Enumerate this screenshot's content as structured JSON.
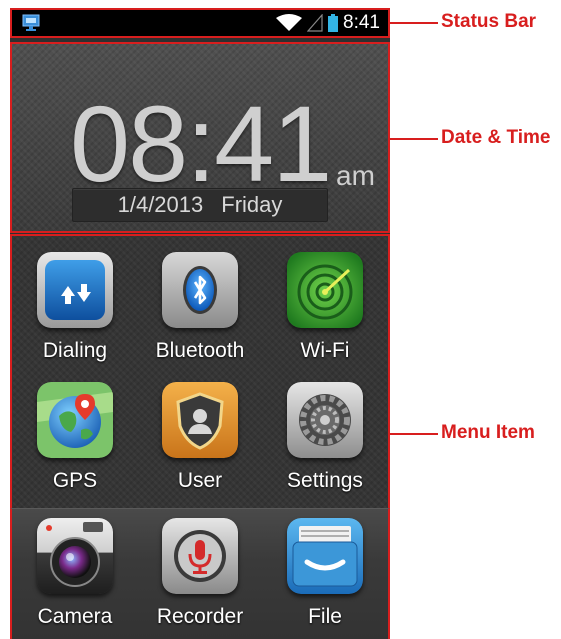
{
  "status_bar": {
    "time": "8:41",
    "icons": [
      "monitor-icon",
      "wifi-icon",
      "signal-icon",
      "battery-icon"
    ]
  },
  "clock": {
    "time": "08:41",
    "ampm": "am",
    "date": "1/4/2013",
    "day": "Friday"
  },
  "apps": [
    {
      "label": "Dialing",
      "icon": "dialing-icon"
    },
    {
      "label": "Bluetooth",
      "icon": "bluetooth-icon"
    },
    {
      "label": "Wi-Fi",
      "icon": "wifi-radar-icon"
    },
    {
      "label": "GPS",
      "icon": "gps-globe-icon"
    },
    {
      "label": "User",
      "icon": "user-shield-icon"
    },
    {
      "label": "Settings",
      "icon": "gear-icon"
    }
  ],
  "dock": [
    {
      "label": "Camera",
      "icon": "camera-icon"
    },
    {
      "label": "Recorder",
      "icon": "microphone-icon"
    },
    {
      "label": "File",
      "icon": "file-box-icon"
    }
  ],
  "annotations": {
    "status_bar": "Status Bar",
    "date_time": "Date & Time",
    "menu_item": "Menu Item"
  },
  "colors": {
    "annotation": "#d81e1e",
    "status_bar_bg": "#000000",
    "panel_bg": "#3c3c3c",
    "label_text": "#ffffff"
  }
}
